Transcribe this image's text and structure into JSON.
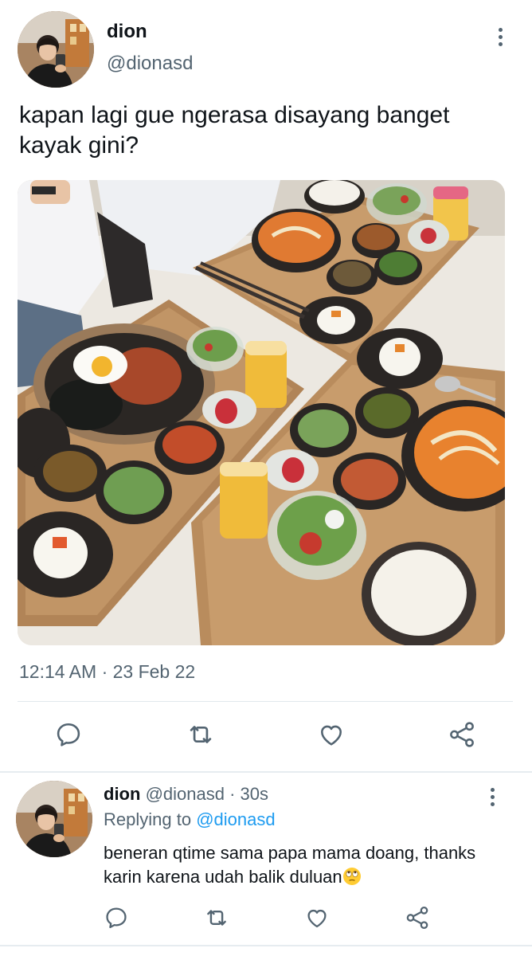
{
  "main_tweet": {
    "author_name": "dion",
    "author_handle": "@dionasd",
    "text": "kapan lagi gue ngerasa disayang banget kayak gini?",
    "timestamp": "12:14 AM · 23 Feb 22",
    "more_icon": "more-vertical-icon",
    "actions": [
      "reply-icon",
      "retweet-icon",
      "like-icon",
      "share-icon"
    ]
  },
  "reply_tweet": {
    "author_name": "dion",
    "author_handle": "@dionasd",
    "separator": "·",
    "time": "30s",
    "replying_prefix": "Replying to",
    "replying_handle": "@dionasd",
    "text": "beneran qtime sama papa mama doang, thanks karin karena udah balik duluan",
    "emoji": "rolling-eyes-emoji",
    "more_icon": "more-vertical-icon",
    "actions": [
      "reply-icon",
      "retweet-icon",
      "like-icon",
      "share-icon"
    ]
  },
  "colors": {
    "text_primary": "#0f1419",
    "text_secondary": "#536471",
    "link": "#1d9bf0",
    "divider": "#e1e8ed"
  }
}
